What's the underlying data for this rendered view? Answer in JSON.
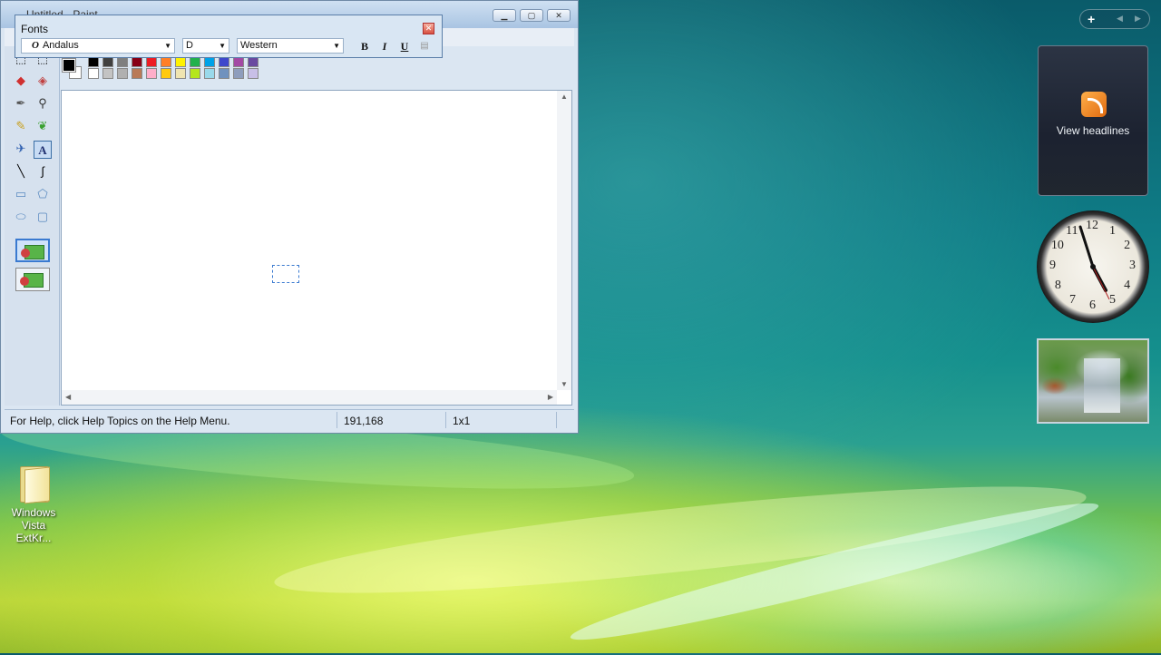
{
  "paint": {
    "title": "Untitled - Paint",
    "status": {
      "help": "For Help, click Help Topics on the Help Menu.",
      "coords": "191,168",
      "size": "1x1"
    },
    "palette_top": [
      "#000000",
      "#404040",
      "#7f7f7f",
      "#880015",
      "#ed1c24",
      "#ff7f27",
      "#fff200",
      "#22b14c",
      "#00a2e8",
      "#3f48cc",
      "#a349a4",
      "#6a4aa0"
    ],
    "palette_bottom": [
      "#ffffff",
      "#c3c3c3",
      "#b0b0b0",
      "#b97a57",
      "#ffaec9",
      "#ffc90e",
      "#efe4b0",
      "#b5e61d",
      "#99d9ea",
      "#7092be",
      "#8e9dbc",
      "#c8bfe7"
    ]
  },
  "fonts_toolbar": {
    "title": "Fonts",
    "font_name": "Andalus",
    "font_size": "D",
    "script": "Western",
    "bold": "B",
    "italic": "I",
    "underline": "U"
  },
  "sidebar": {
    "feed_label": "View headlines"
  },
  "clock": {
    "numerals": [
      "12",
      "1",
      "2",
      "3",
      "4",
      "5",
      "6",
      "7",
      "8",
      "9",
      "10",
      "11"
    ]
  },
  "desktop": {
    "icon_label": "Windows Vista ExtKr..."
  }
}
